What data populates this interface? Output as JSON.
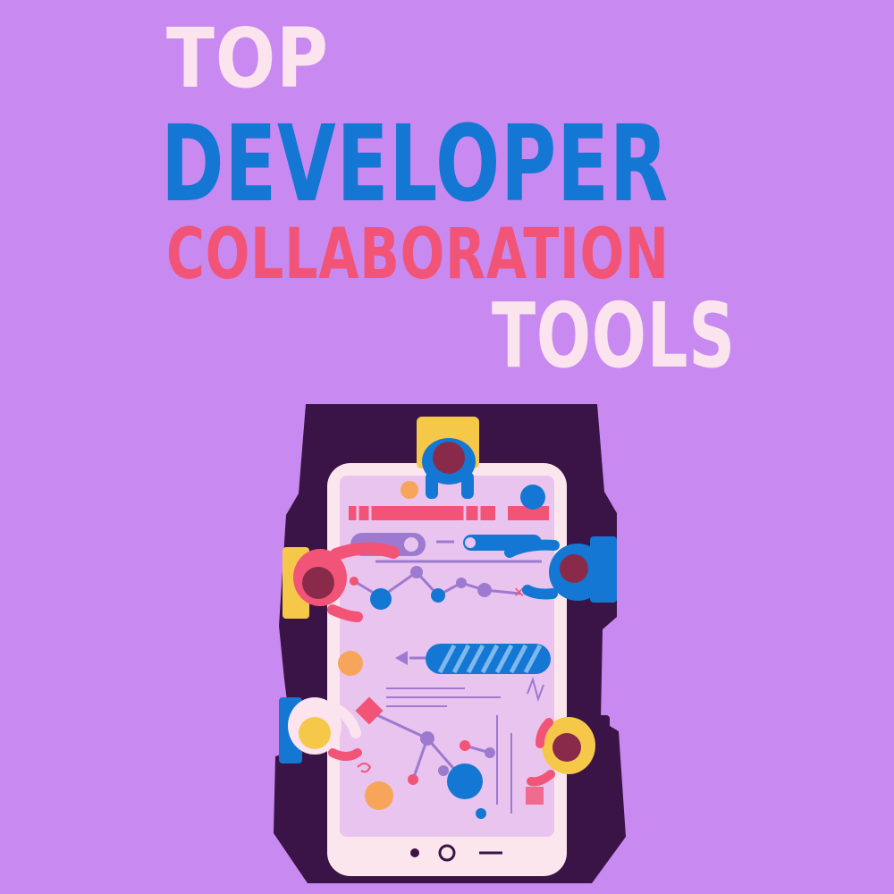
{
  "headline": {
    "line1": "TOP",
    "line2": "DEVELOPER",
    "line3": "COLLABORATION",
    "line4": "TOOLS"
  },
  "colors": {
    "background": "#c88af0",
    "title_light": "#fbe4ee",
    "title_blue": "#1477d4",
    "title_pink": "#f25478",
    "table_dark": "#3a1446",
    "screen": "#e9c4ee"
  },
  "illustration": {
    "people_count": 5,
    "icons": [
      "tablet-table-icon",
      "line-chart-icon",
      "progress-bar-icon",
      "play-back-icon"
    ]
  }
}
